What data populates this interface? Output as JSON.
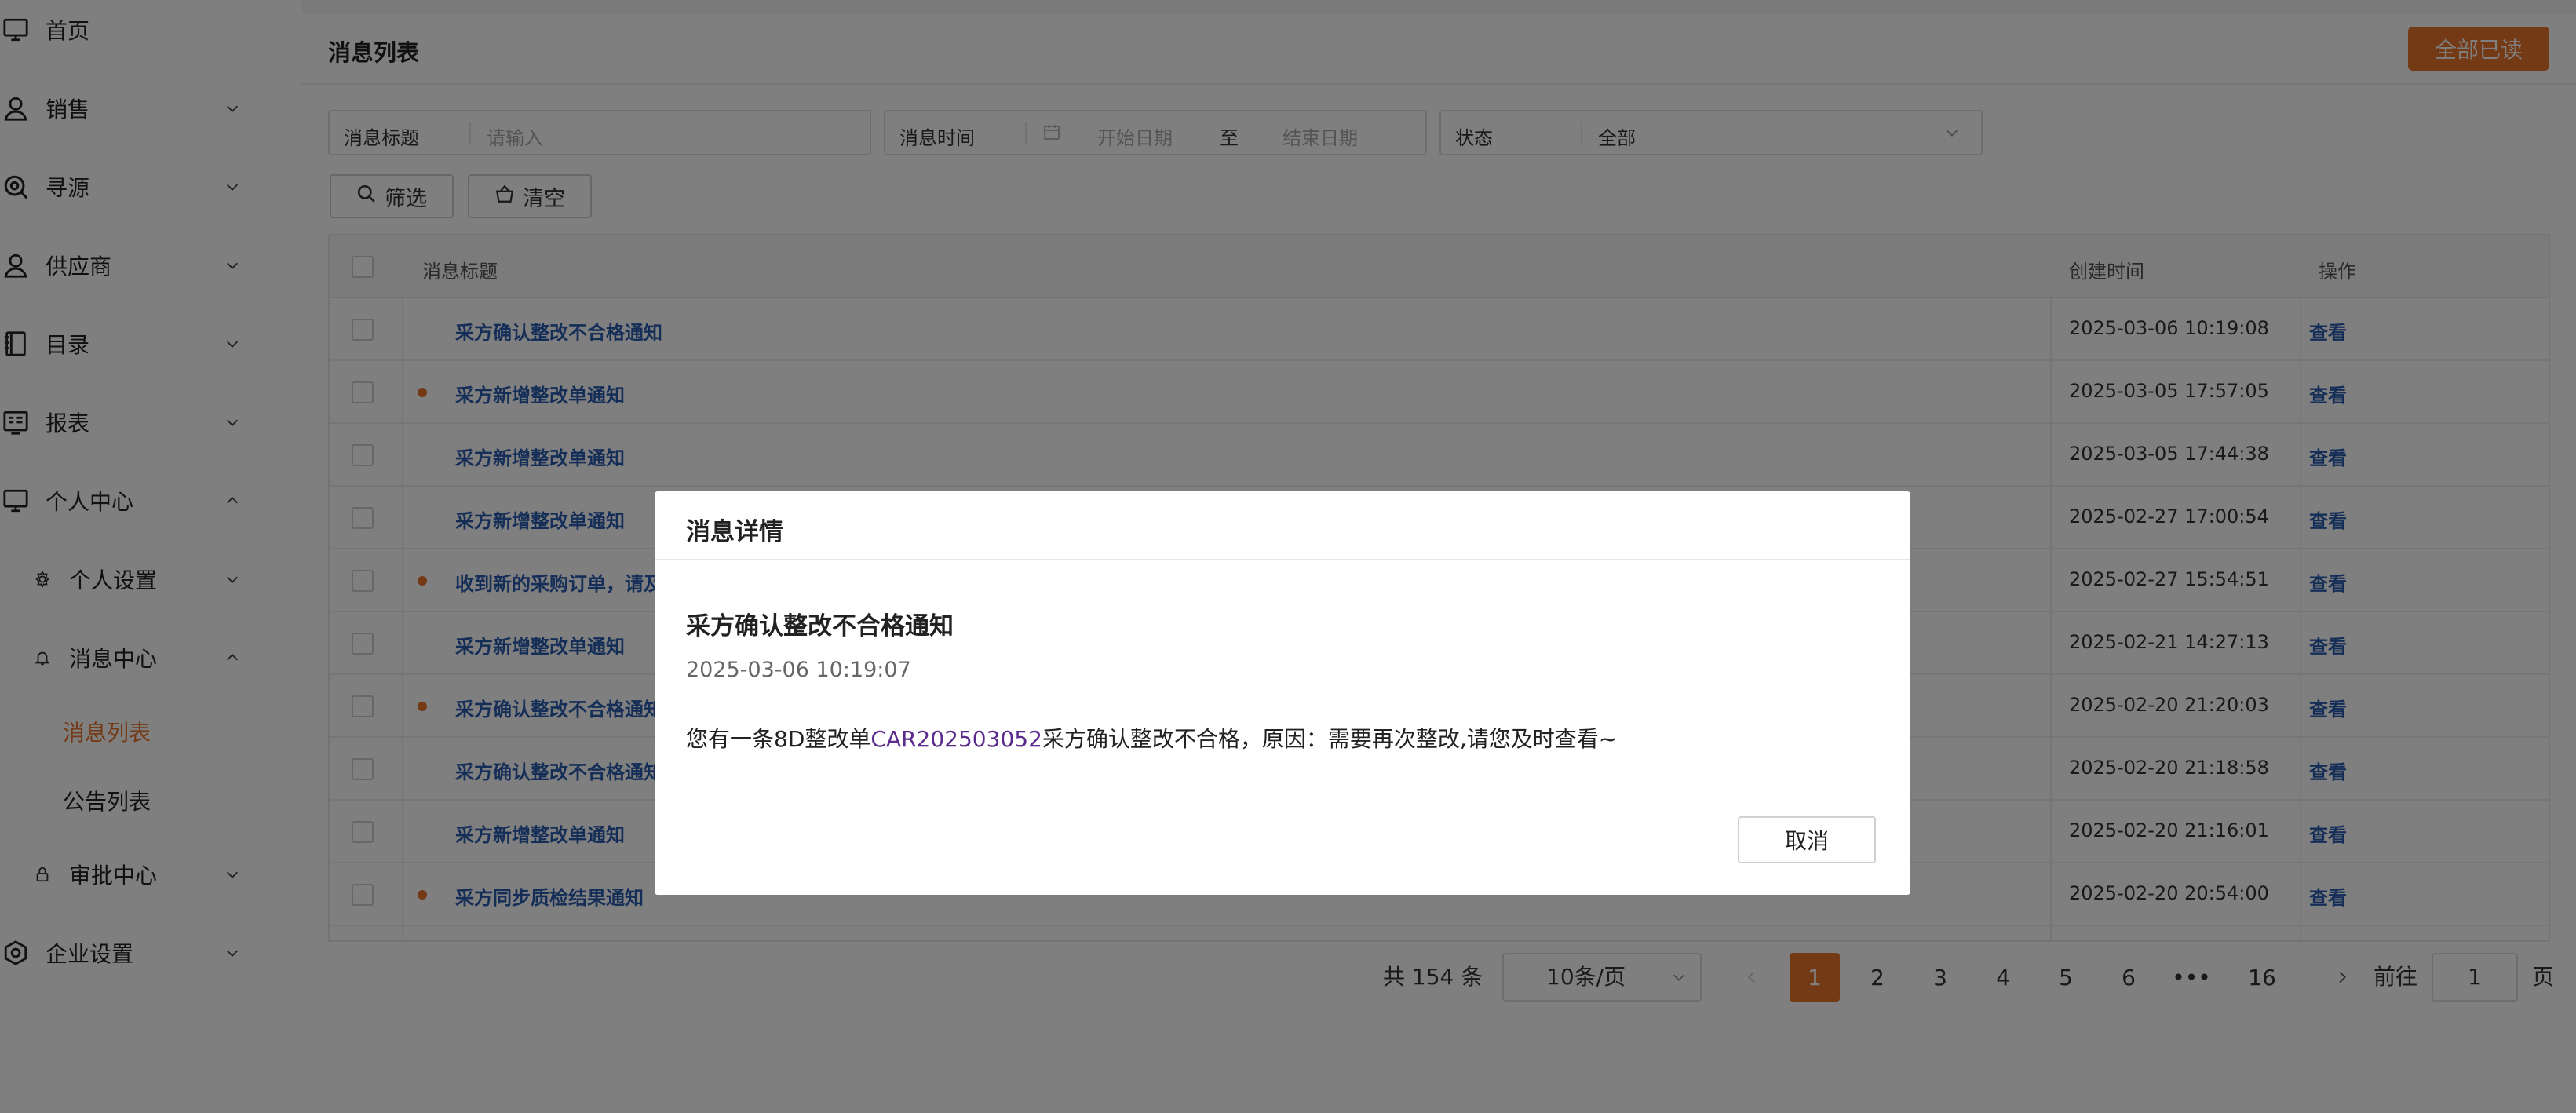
{
  "sidebar": {
    "items": [
      {
        "label": "首页",
        "icon": "monitor-icon"
      },
      {
        "label": "销售",
        "icon": "user-icon"
      },
      {
        "label": "寻源",
        "icon": "search-zoom-icon"
      },
      {
        "label": "供应商",
        "icon": "user-icon"
      },
      {
        "label": "目录",
        "icon": "book-icon"
      },
      {
        "label": "报表",
        "icon": "report-icon"
      },
      {
        "label": "个人中心",
        "icon": "monitor-icon"
      },
      {
        "label": "个人设置",
        "icon": "gear-icon"
      },
      {
        "label": "消息中心",
        "icon": "bell-icon"
      },
      {
        "label": "消息列表"
      },
      {
        "label": "公告列表"
      },
      {
        "label": "审批中心",
        "icon": "lock-icon"
      },
      {
        "label": "企业设置",
        "icon": "hexagon-gear-icon"
      }
    ]
  },
  "header": {
    "title": "消息列表",
    "mark_all_label": "全部已读"
  },
  "filters": {
    "title_label": "消息标题",
    "title_placeholder": "请输入",
    "time_label": "消息时间",
    "start_placeholder": "开始日期",
    "to_label": "至",
    "end_placeholder": "结束日期",
    "status_label": "状态",
    "status_value": "全部",
    "filter_button": "筛选",
    "clear_button": "清空"
  },
  "table": {
    "headers": {
      "title": "消息标题",
      "time": "创建时间",
      "action": "操作"
    },
    "rows": [
      {
        "title": "采方确认整改不合格通知",
        "time": "2025-03-06 10:19:08",
        "action": "查看",
        "unread": false
      },
      {
        "title": "采方新增整改单通知",
        "time": "2025-03-05 17:57:05",
        "action": "查看",
        "unread": true
      },
      {
        "title": "采方新增整改单通知",
        "time": "2025-03-05 17:44:38",
        "action": "查看",
        "unread": false
      },
      {
        "title": "采方新增整改单通知",
        "time": "2025-02-27 17:00:54",
        "action": "查看",
        "unread": false
      },
      {
        "title": "收到新的采购订单，请及",
        "time": "2025-02-27 15:54:51",
        "action": "查看",
        "unread": true
      },
      {
        "title": "采方新增整改单通知",
        "time": "2025-02-21 14:27:13",
        "action": "查看",
        "unread": false
      },
      {
        "title": "采方确认整改不合格通知",
        "time": "2025-02-20 21:20:03",
        "action": "查看",
        "unread": true
      },
      {
        "title": "采方确认整改不合格通知",
        "time": "2025-02-20 21:18:58",
        "action": "查看",
        "unread": false
      },
      {
        "title": "采方新增整改单通知",
        "time": "2025-02-20 21:16:01",
        "action": "查看",
        "unread": false
      },
      {
        "title": "采方同步质检结果通知",
        "time": "2025-02-20 20:54:00",
        "action": "查看",
        "unread": true
      }
    ]
  },
  "pagination": {
    "total": "共 154 条",
    "page_size": "10条/页",
    "pages": [
      "1",
      "2",
      "3",
      "4",
      "5",
      "6",
      "•••",
      "16"
    ],
    "current": "1",
    "goto_label": "前往",
    "goto_value": "1",
    "page_suffix": "页"
  },
  "modal": {
    "title": "消息详情",
    "message_title": "采方确认整改不合格通知",
    "message_time": "2025-03-06 10:19:07",
    "body_prefix": "您有一条8D整改单",
    "body_link": "CAR202503052",
    "body_suffix": "采方确认整改不合格，原因：需要再次整改,请您及时查看~",
    "cancel_label": "取消"
  },
  "colors": {
    "accent": "#e8732a",
    "link": "#2a5db0",
    "overlay": "rgba(0,0,0,0.5)"
  }
}
